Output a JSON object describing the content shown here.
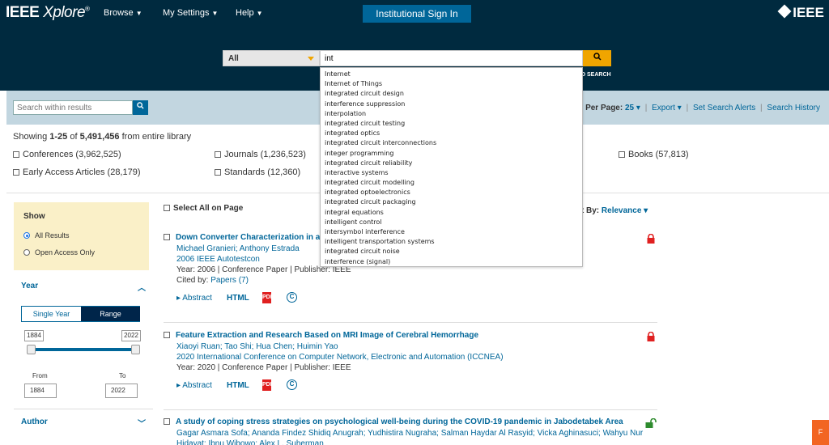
{
  "header": {
    "logo_main": "IEEE",
    "logo_italic": "Xplore",
    "logo_reg": "®",
    "nav": [
      "Browse",
      "My Settings",
      "Help"
    ],
    "signin": "Institutional Sign In",
    "brand_right": "IEEE"
  },
  "search": {
    "scope": "All",
    "query": "int",
    "button_icon": "search-icon",
    "advanced_partial": "D SEARCH",
    "suggestions": [
      "Internet",
      "Internet of Things",
      "integrated circuit design",
      "interference suppression",
      "interpolation",
      "integrated circuit testing",
      "integrated optics",
      "integrated circuit interconnections",
      "integer programming",
      "integrated circuit reliability",
      "interactive systems",
      "integrated circuit modelling",
      "integrated optoelectronics",
      "integrated circuit packaging",
      "integral equations",
      "intelligent control",
      "intersymbol interference",
      "intelligent transportation systems",
      "integrated circuit noise",
      "interference (signal)"
    ]
  },
  "toolbar": {
    "within_placeholder": "Search within results",
    "per_page_label": "Per Page:",
    "per_page_value": "25",
    "export": "Export",
    "alerts": "Set Search Alerts",
    "history": "Search History"
  },
  "summary": {
    "prefix": "Showing",
    "range": "1-25",
    "of": "of",
    "total": "5,491,456",
    "suffix": "from entire library"
  },
  "content_types": [
    {
      "label": "Conferences (3,962,525)"
    },
    {
      "label": "Journals (1,236,523)"
    },
    {
      "label": "Books (57,813)"
    },
    {
      "label": "Early Access Articles (28,179)"
    },
    {
      "label": "Standards (12,360)"
    }
  ],
  "sidebar": {
    "show_title": "Show",
    "show_options": [
      "All Results",
      "Open Access Only"
    ],
    "year_title": "Year",
    "year_modes": [
      "Single Year",
      "Range"
    ],
    "year_min": "1884",
    "year_max": "2022",
    "from_label": "From",
    "to_label": "To",
    "from_value": "1884",
    "to_value": "2022",
    "author_title": "Author"
  },
  "results_header": {
    "select_all": "Select All on Page",
    "sort_label": "rt By:",
    "sort_value": "Relevance"
  },
  "results": [
    {
      "title": "Down Converter Characterization in a Sy",
      "authors": "Michael Granieri; Anthony Estrada",
      "venue": "2006 IEEE Autotestcon",
      "meta": "Year: 2006  |  Conference Paper  |  Publisher:  IEEE",
      "cited_prefix": "Cited by: ",
      "cited_link": "Papers (7)",
      "abstract": "Abstract",
      "html": "HTML",
      "lock": "locked"
    },
    {
      "title": "Feature Extraction and Research Based on MRI Image of Cerebral Hemorrhage",
      "authors": "Xiaoyi Ruan; Tao Shi; Hua Chen; Huimin Yao",
      "venue": "2020 International Conference on Computer Network, Electronic and Automation (ICCNEA)",
      "meta": "Year: 2020  |  Conference Paper  |  Publisher:  IEEE",
      "abstract": "Abstract",
      "html": "HTML",
      "lock": "locked"
    },
    {
      "title": "A study of coping stress strategies on psychological well-being during the COVID-19 pandemic in Jabodetabek Area",
      "authors": "Gagar Asmara Sofa; Ananda Findez Shidiq Anugrah; Yudhistira Nugraha; Salman Haydar Al Rasyid; Vicka Aghinasuci; Wahyu Nur",
      "authors2": "Hidayat; Ibnu Wibowo; Alex L. Suherman",
      "lock": "open"
    }
  ],
  "colors": {
    "header_bg": "#002a3f",
    "accent_blue": "#006699",
    "search_orange": "#f0a500",
    "lock_red": "#e02020",
    "open_green": "#2e8b2e",
    "subbar_bg": "#c2d6e0",
    "show_panel_bg": "#faf0c8"
  },
  "feedback_tab": "F"
}
